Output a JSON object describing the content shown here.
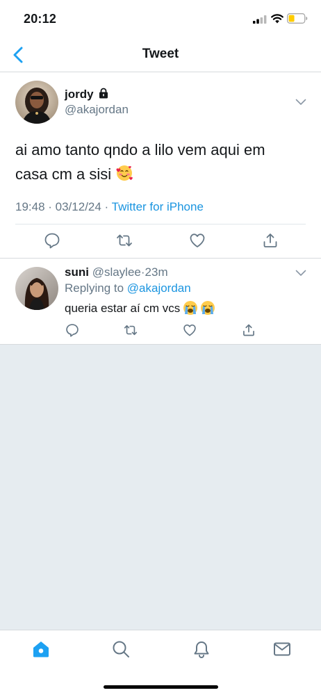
{
  "status_bar": {
    "time": "20:12"
  },
  "header": {
    "title": "Tweet",
    "back_icon": "chevron-left-icon"
  },
  "tweet": {
    "author_name": "jordy",
    "author_handle": "@akajordan",
    "protected": true,
    "text": "ai amo tanto qndo a lilo vem aqui em casa cm a sisi",
    "text_emoji": "smiling-face-with-hearts-emoji",
    "timestamp": "19:48 · 03/12/24 · ",
    "source": "Twitter for iPhone",
    "actions": [
      "reply-icon",
      "retweet-icon",
      "like-icon",
      "share-icon"
    ]
  },
  "reply": {
    "author_name": "suni",
    "author_handle": "@slaylee",
    "time": "·23m",
    "replying_prefix": "Replying to ",
    "replying_to": "@akajordan",
    "text": "queria estar aí cm vcs",
    "text_emojis": [
      "loudly-crying-face-emoji",
      "loudly-crying-face-emoji"
    ],
    "actions": [
      "reply-icon",
      "retweet-icon",
      "like-icon",
      "share-icon"
    ]
  },
  "tab_bar": {
    "tabs": [
      "home-icon",
      "search-icon",
      "notifications-icon",
      "messages-icon"
    ],
    "active": "home-icon"
  },
  "colors": {
    "accent": "#1da1f2",
    "link": "#1b95e0",
    "muted_text": "#657786",
    "background_empty": "#e6ecf0",
    "battery_low": "#ffcc00"
  }
}
